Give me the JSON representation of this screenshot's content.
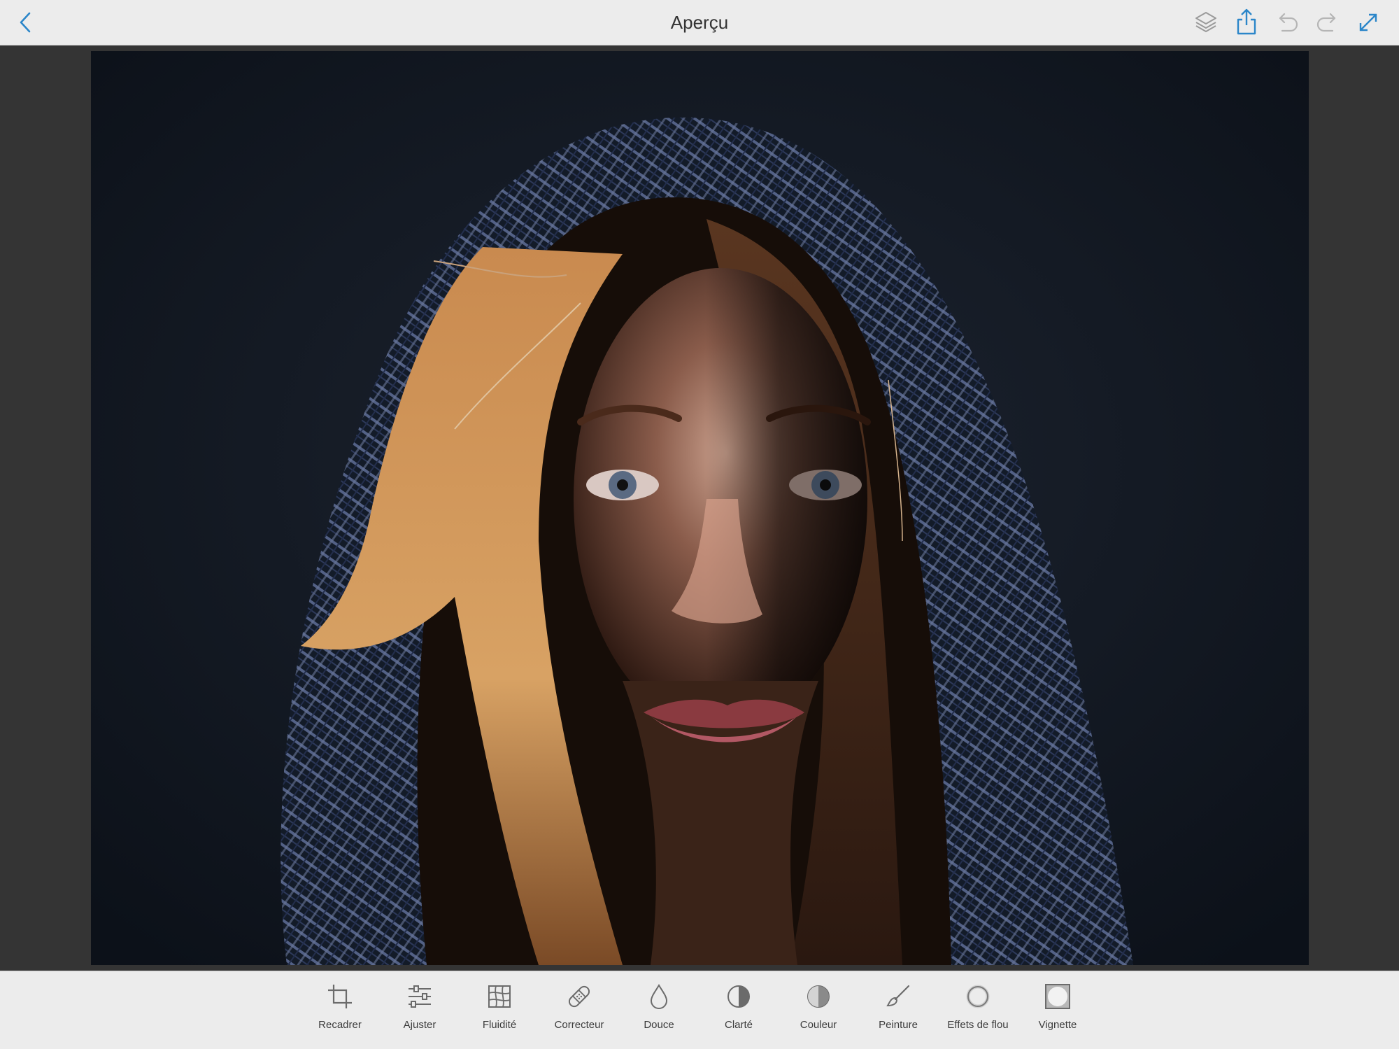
{
  "header": {
    "title": "Aperçu",
    "back_icon": "chevron-left-icon",
    "actions": [
      {
        "name": "layers-button",
        "icon": "layers-icon"
      },
      {
        "name": "share-button",
        "icon": "share-icon"
      },
      {
        "name": "undo-button",
        "icon": "undo-icon"
      },
      {
        "name": "redo-button",
        "icon": "redo-icon"
      },
      {
        "name": "fullscreen-button",
        "icon": "expand-icon"
      }
    ]
  },
  "toolbar": {
    "tools": [
      {
        "label": "Recadrer",
        "icon": "crop-icon"
      },
      {
        "label": "Ajuster",
        "icon": "sliders-icon"
      },
      {
        "label": "Fluidité",
        "icon": "liquify-grid-icon"
      },
      {
        "label": "Correcteur",
        "icon": "bandage-icon"
      },
      {
        "label": "Douce",
        "icon": "drop-icon"
      },
      {
        "label": "Clarté",
        "icon": "half-circle-icon"
      },
      {
        "label": "Couleur",
        "icon": "color-circle-icon"
      },
      {
        "label": "Peinture",
        "icon": "brush-icon"
      },
      {
        "label": "Effets de flou",
        "icon": "blur-ring-icon"
      },
      {
        "label": "Vignette",
        "icon": "vignette-icon"
      }
    ]
  },
  "colors": {
    "accent": "#2b86c9",
    "bar_background": "#ececec",
    "canvas_background": "#343434",
    "icon_gray": "#6b6b6b",
    "icon_disabled": "#b5b5b5"
  }
}
